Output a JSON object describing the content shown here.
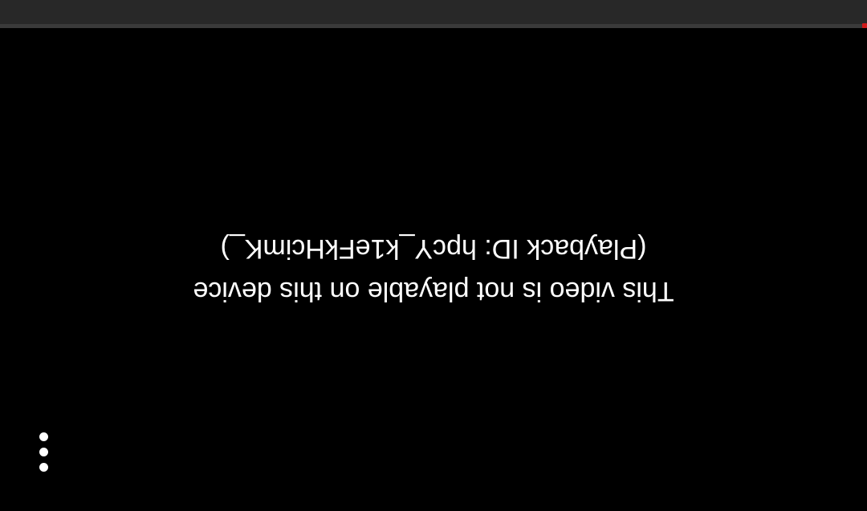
{
  "player": {
    "error_message": "This video is not playable on this device",
    "playback_id_text": "(Playback ID: hpcY_k1eFkHcimK_)"
  },
  "icons": {
    "menu": "more-vertical-icon"
  },
  "colors": {
    "background": "#000000",
    "top_bar": "#282828",
    "text": "#ffffff",
    "progress_accent": "#d11a1a"
  }
}
